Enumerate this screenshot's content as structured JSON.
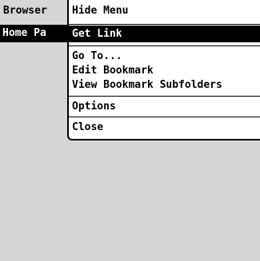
{
  "browser": {
    "title": "Browser",
    "page_label": "Home Pa"
  },
  "menu": {
    "hide_label": "Hide Menu",
    "items": [
      {
        "label": "Get Link"
      },
      {
        "label": "Go To..."
      },
      {
        "label": "Edit Bookmark"
      },
      {
        "label": "View Bookmark Subfolders"
      },
      {
        "label": "Options"
      },
      {
        "label": "Close"
      }
    ]
  }
}
